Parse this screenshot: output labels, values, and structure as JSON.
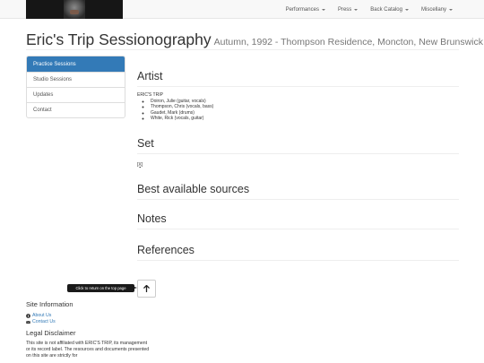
{
  "navbar": {
    "menu": [
      {
        "label": "Performances"
      },
      {
        "label": "Press"
      },
      {
        "label": "Back Catalog"
      },
      {
        "label": "Miscellany"
      }
    ]
  },
  "header": {
    "title": "Eric's Trip Sessionography",
    "subtitle": "Autumn, 1992 - Thompson Residence, Moncton, New Brunswick"
  },
  "sidebar": {
    "items": [
      {
        "label": "Practice Sessions",
        "active": true
      },
      {
        "label": "Studio Sessions"
      },
      {
        "label": "Updates"
      },
      {
        "label": "Contact"
      }
    ]
  },
  "main": {
    "artist": {
      "heading": "Artist",
      "band": "ERIC'S TRIP",
      "members": [
        "Doiron, Julie (guitar, vocals)",
        "Thompson, Chris (vocals, bass)",
        "Gaudet, Mark (drums)",
        "White, Rick (vocals, guitar)"
      ]
    },
    "set": {
      "heading": "Set",
      "link": "[X]"
    },
    "sources": {
      "heading": "Best available sources"
    },
    "notes": {
      "heading": "Notes"
    },
    "references": {
      "heading": "References"
    }
  },
  "back_to_top": {
    "tooltip": "Click to return on the top page"
  },
  "footer": {
    "site_info_heading": "Site Information",
    "about_label": "About Us",
    "contact_label": "Contact Us",
    "legal_heading": "Legal Disclaimer",
    "disclaimer_text": "This site is not affiliated with ERIC'S TRIP, its management or its record label. The resources and documents presented on this site are strictly for"
  },
  "colors": {
    "accent": "#337ab7",
    "navbar_bg": "#f8f8f8",
    "brand_bg": "#161616"
  }
}
